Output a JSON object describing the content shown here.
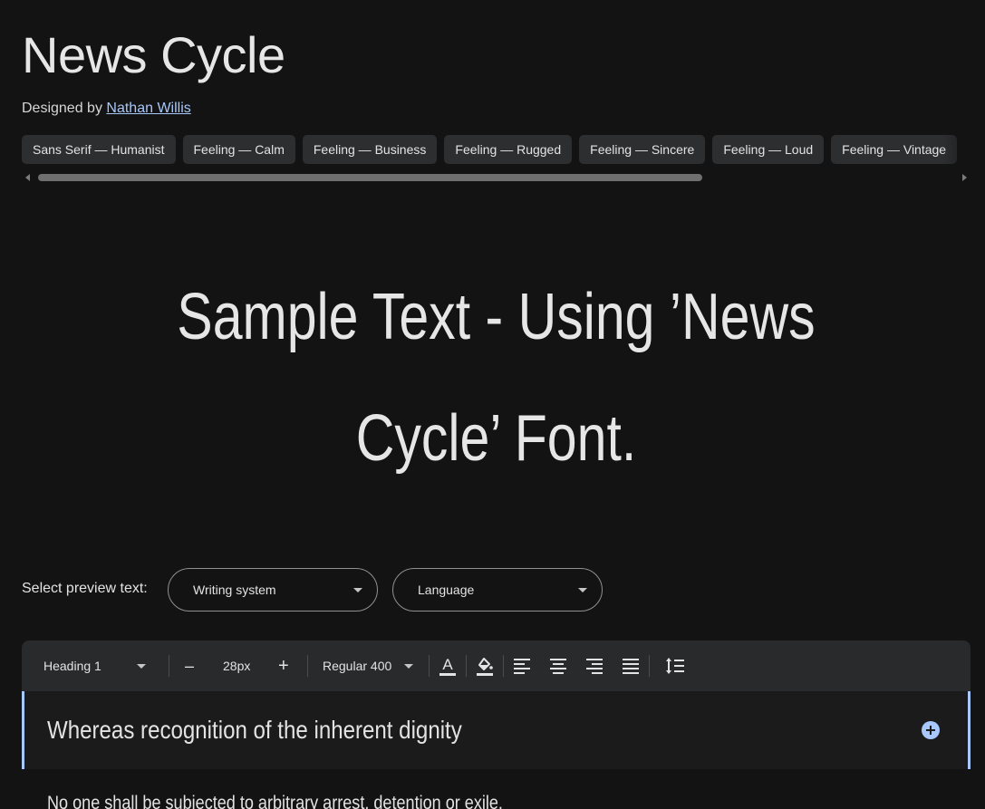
{
  "font": {
    "name": "News Cycle",
    "designed_by_label": "Designed by",
    "designer": "Nathan Willis"
  },
  "tags": [
    "Sans Serif — Humanist",
    "Feeling — Calm",
    "Feeling — Business",
    "Feeling — Rugged",
    "Feeling — Sincere",
    "Feeling — Loud",
    "Feeling — Vintage"
  ],
  "sample_text": "Sample Text - Using ’News Cycle’ Font.",
  "preview": {
    "label": "Select preview text:",
    "writing_system_placeholder": "Writing system",
    "language_placeholder": "Language"
  },
  "toolbar": {
    "style": "Heading 1",
    "decrease_label": "–",
    "size": "28px",
    "increase_label": "+",
    "weight": "Regular 400"
  },
  "editor": {
    "line1": "Whereas recognition of the inherent dignity",
    "line2": "No one shall be subjected to arbitrary arrest, detention or exile."
  },
  "colors": {
    "background": "#131313",
    "accent": "#a8c7fa",
    "chip": "#2d2e30",
    "toolbar": "#282a2c"
  }
}
